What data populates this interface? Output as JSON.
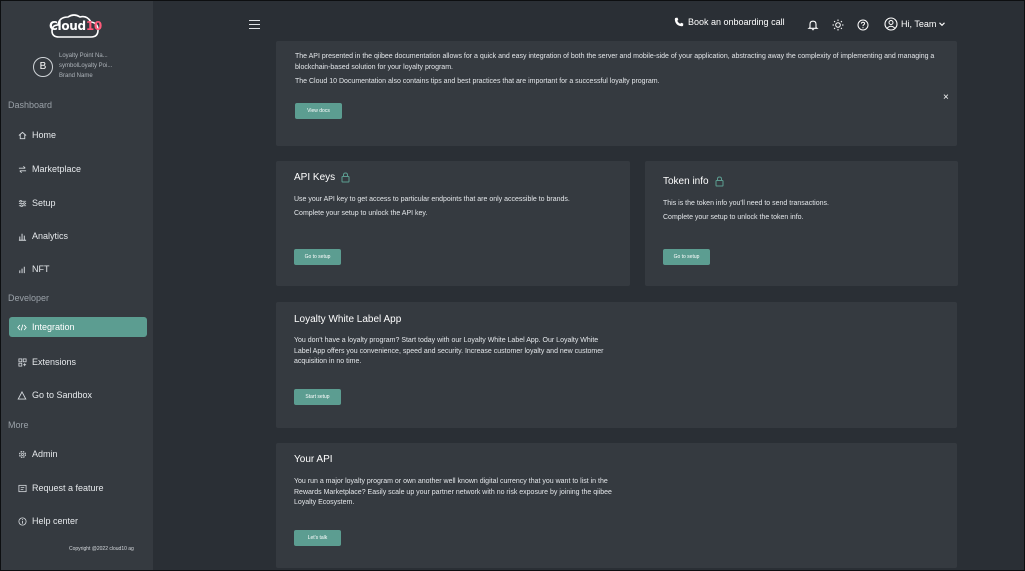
{
  "app": {
    "logo_main": "Cloud",
    "logo_accent": "10"
  },
  "brand": {
    "avatar_letter": "B",
    "line1": "Loyalty Point Na...",
    "line2": "symbolLoyalty Poi...",
    "line3": "Brand Name"
  },
  "sidebar": {
    "sections": {
      "dashboard": "Dashboard",
      "developer": "Developer",
      "more": "More"
    },
    "items": {
      "home": "Home",
      "marketplace": "Marketplace",
      "setup": "Setup",
      "analytics": "Analytics",
      "nft": "NFT",
      "integration": "Integration",
      "extensions": "Extensions",
      "sandbox": "Go to Sandbox",
      "admin": "Admin",
      "request": "Request a feature",
      "help": "Help center"
    },
    "copyright": "Copyright @2022 cloud10 ag"
  },
  "topbar": {
    "onboarding": "Book an onboarding call",
    "user": "Hi, Team"
  },
  "docs_card": {
    "text1": "The API presented in the qiibee documentation allows for a quick and easy integration of both the server and mobile-side of your application, abstracting away the complexity of implementing and managing a blockchain-based solution for your loyalty program.",
    "text2": "The Cloud 10  Documentation also contains tips and best practices that are important for a successful loyalty program.",
    "button": "View docs",
    "close": "×"
  },
  "api_keys": {
    "title": "API Keys",
    "line1": "Use your API key to get access to particular endpoints that are only accessible to brands.",
    "line2": "Complete your setup to unlock the API key.",
    "button": "Go to setup"
  },
  "token_info": {
    "title": "Token info",
    "line1": "This is the token info you'll need to send transactions.",
    "line2": "Complete your setup to unlock the token info.",
    "button": "Go to setup"
  },
  "white_label": {
    "title": "Loyalty White Label App",
    "text": "You don't have a loyalty program? Start today with our Loyalty White Label App. Our Loyalty White Label App offers you convenience, speed and security. Increase customer loyalty and new customer acquisition in no time.",
    "button": "Start setup"
  },
  "your_api": {
    "title": "Your API",
    "text": "You run a major loyalty program or own another well known digital currency that you want to list in the Rewards Marketplace? Easily scale up your partner network with no risk exposure by joining the qiibee Loyalty Ecosystem.",
    "button": "Let's talk"
  },
  "colors": {
    "accent": "#5c9d91",
    "logo_accent": "#ff5a7a"
  }
}
